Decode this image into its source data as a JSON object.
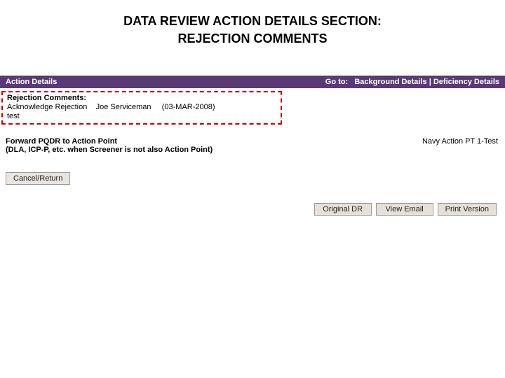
{
  "heading": {
    "line1": "DATA REVIEW ACTION DETAILS SECTION:",
    "line2": "REJECTION COMMENTS"
  },
  "sectionHeader": {
    "title": "Action Details",
    "goto_label": "Go to:",
    "link_bg": "Background Details",
    "sep": " | ",
    "link_def": "Deficiency Details"
  },
  "rejection": {
    "title": "Rejection Comments:",
    "line1_prefix": "Acknowledge Rejection",
    "line1_name": "Joe Serviceman",
    "line1_date": "(03-MAR-2008)",
    "line2": "test"
  },
  "forward": {
    "title": "Forward PQDR to Action Point",
    "sub": "(DLA, ICP-P, etc. when Screener is not also Action Point)",
    "right": "Navy Action PT 1-Test"
  },
  "buttons": {
    "cancel": "Cancel/Return",
    "original": "Original DR",
    "view_email": "View Email",
    "print": "Print Version"
  }
}
